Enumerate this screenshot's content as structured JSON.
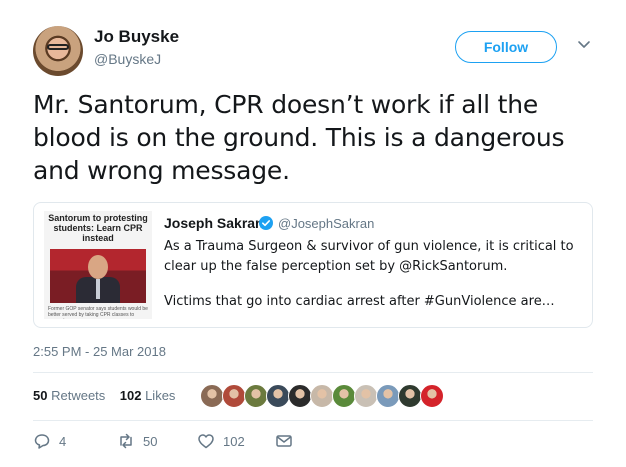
{
  "author": {
    "name": "Jo Buyske",
    "handle": "@BuyskeJ"
  },
  "follow_label": "Follow",
  "tweet_text": "Mr. Santorum, CPR doesn’t work if all the blood is on the ground.  This is a dangerous and wrong message.",
  "quoted": {
    "thumbnail_title": "Santorum to protesting students: Learn CPR instead",
    "thumbnail_caption": "Former GOP senator says students would be better served by taking CPR classes to prevent",
    "name": "Joseph Sakran",
    "handle": "@JosephSakran",
    "text_line1": "As a Trauma Surgeon & survivor of gun violence, it is critical to clear up the false perception set by @RickSantorum.",
    "text_line2": "Victims that go into cardiac arrest after #GunViolence are…"
  },
  "timestamp": "2:55 PM - 25 Mar 2018",
  "stats": {
    "retweets_count": "50",
    "retweets_label": "Retweets",
    "likes_count": "102",
    "likes_label": "Likes"
  },
  "liker_avatars": [
    "#8a6a55",
    "#b04a3a",
    "#6b7a3e",
    "#3a4a5a",
    "#2b2b2b",
    "#c7b8a8",
    "#5a8a3a",
    "#c9c0b5",
    "#7a9aba",
    "#2f3a2f",
    "#d4232a"
  ],
  "actions": {
    "reply_count": "4",
    "retweet_count": "50",
    "like_count": "102"
  },
  "colors": {
    "accent": "#1da1f2",
    "secondary_text": "#657786"
  }
}
